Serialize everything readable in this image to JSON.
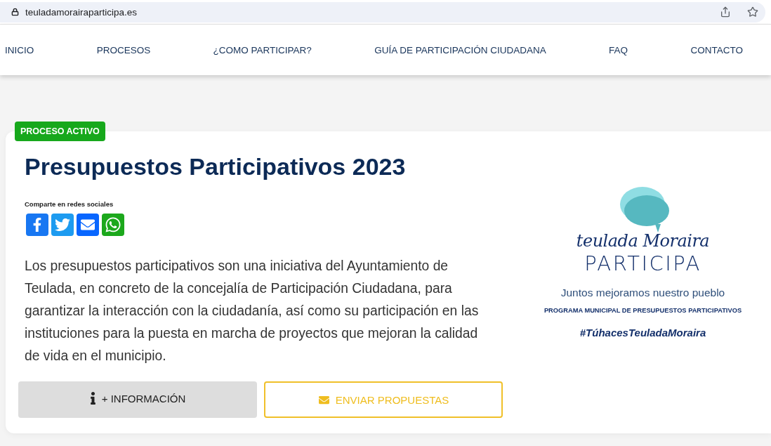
{
  "browser": {
    "url": "teuladamorairaparticipa.es"
  },
  "nav": {
    "items": [
      {
        "label": "INICIO"
      },
      {
        "label": "PROCESOS"
      },
      {
        "label": "¿COMO PARTICIPAR?"
      },
      {
        "label": "GUÍA DE PARTICIPACIÓN CIUDADANA"
      },
      {
        "label": "FAQ"
      },
      {
        "label": "CONTACTO"
      }
    ]
  },
  "process": {
    "badge": "PROCESO ACTIVO",
    "title": "Presupuestos Participativos 2023",
    "share": {
      "label": "Comparte en redes sociales",
      "networks": [
        {
          "kind": "facebook",
          "color": "#1877f2"
        },
        {
          "kind": "twitter",
          "color": "#1d9bf0"
        },
        {
          "kind": "email",
          "color": "#0866ff"
        },
        {
          "kind": "whatsapp",
          "color": "#1ca81c"
        }
      ]
    },
    "description": "Los presupuestos participativos son una iniciativa del Ayuntamiento de Teulada, en concreto de la concejalía de Participación Ciudadana, para garantizar la interacción con la ciudadanía, así como su participación en las instituciones para la puesta en marcha de proyectos que mejoran la calidad de vida en el municipio.",
    "buttons": [
      {
        "kind": "info",
        "label": "+ INFORMACIÓN"
      },
      {
        "kind": "send",
        "label": "ENVIAR PROPUESTAS"
      }
    ]
  },
  "logo": {
    "script": "teulada Moraira",
    "wordmark": "PARTICIPA",
    "tagline": "Juntos mejoramos nuestro pueblo",
    "program": "PROGRAMA MUNICIPAL DE PRESUPUESTOS PARTICIPATIVOS",
    "hashtag": "#TúhacesTeuladaMoraira"
  }
}
